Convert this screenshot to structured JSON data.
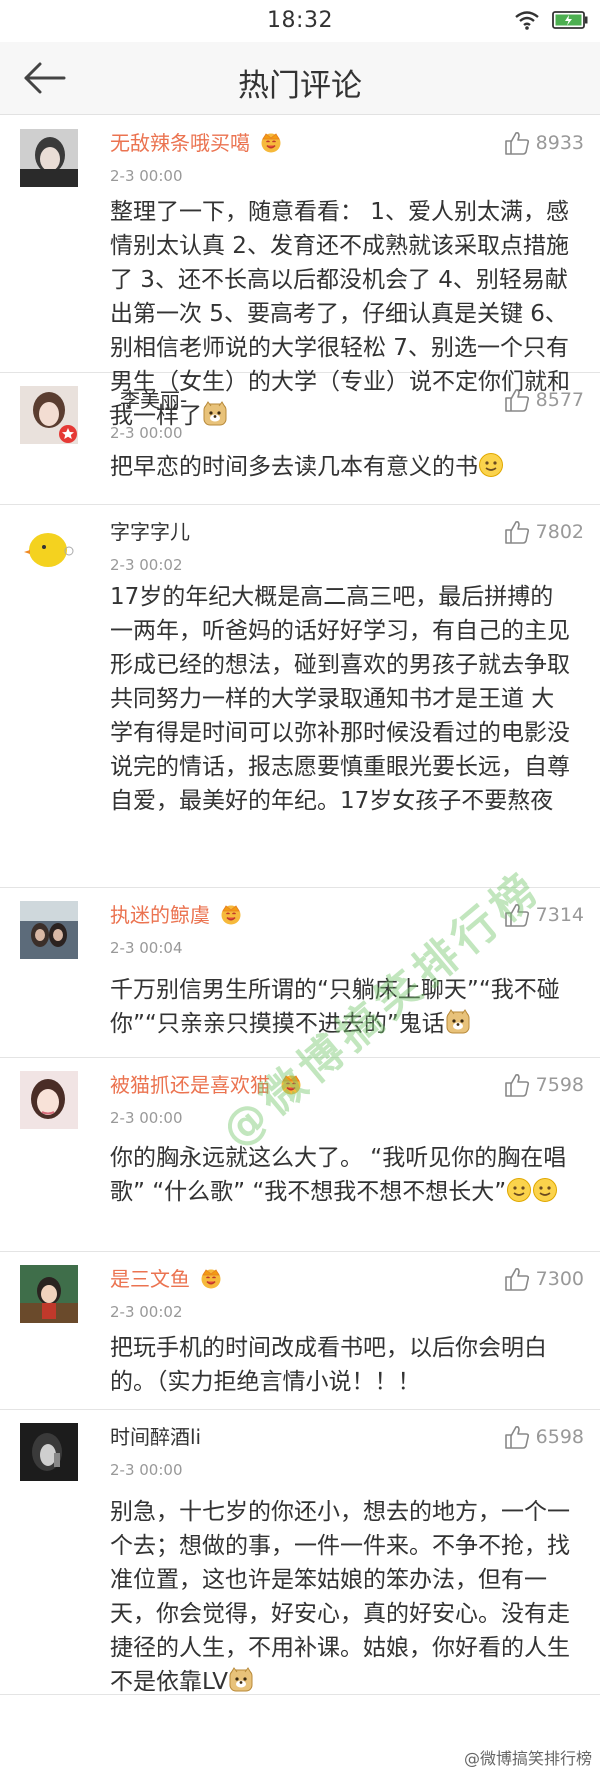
{
  "status_bar": {
    "time": "18:32",
    "icons": [
      "wifi-icon",
      "battery-icon"
    ]
  },
  "header": {
    "title": "热门评论",
    "back_icon": "back-arrow-icon"
  },
  "colors": {
    "accent_orange": "#eb7350",
    "gray_text": "#999999",
    "divider": "#e4e4e4"
  },
  "comments": [
    {
      "user": "无敌辣条哦买噶",
      "vip": true,
      "time": "2-3 00:00",
      "likes": "8933",
      "text": "整理了一下，随意看看： 1、爱人别太满，感情别太认真 2、发育还不成熟就该采取点措施了 3、还不长高以后都没机会了 4、别轻易献出第一次 5、要高考了，仔细认真是关键 6、别相信老师说的大学很轻松 7、别选一个只有男生（女生）的大学（专业）说不定你们就和我一样了"
    },
    {
      "user": "_李美丽-",
      "vip": false,
      "time": "2-3 00:00",
      "likes": "8577",
      "text": "把早恋的时间多去读几本有意义的书"
    },
    {
      "user": "字字字儿",
      "vip": false,
      "time": "2-3 00:02",
      "likes": "7802",
      "text": "17岁的年纪大概是高二高三吧，最后拼搏的一两年，听爸妈的话好好学习，有自己的主见形成已经的想法，碰到喜欢的男孩子就去争取 共同努力一样的大学录取通知书才是王道 大学有得是时间可以弥补那时候没看过的电影没说完的情话，报志愿要慎重眼光要长远，自尊自爱，最美好的年纪。17岁女孩子不要熬夜"
    },
    {
      "user": "执迷的鲸虞",
      "vip": true,
      "time": "2-3 00:04",
      "likes": "7314",
      "text": "千万别信男生所谓的“只躺床上聊天”“我不碰你”“只亲亲只摸摸不进去的”鬼话"
    },
    {
      "user": "被猫抓还是喜欢猫",
      "vip": true,
      "time": "2-3 00:00",
      "likes": "7598",
      "text": "你的胸永远就这么大了。 “我听见你的胸在唱歌” “什么歌” “我不想我不想不想长大”"
    },
    {
      "user": "是三文鱼",
      "vip": true,
      "time": "2-3 00:02",
      "likes": "7300",
      "text": "把玩手机的时间改成看书吧，以后你会明白的。（实力拒绝言情小说！！！"
    },
    {
      "user": "时间醉酒li",
      "vip": false,
      "time": "2-3 00:00",
      "likes": "6598",
      "text": "别急，十七岁的你还小，想去的地方，一个一个去；想做的事，一件一件来。不争不抢，找准位置，这也许是笨姑娘的笨办法，但有一天，你会觉得，好安心，真的好安心。没有走捷径的人生，不用补课。姑娘，你好看的人生不是依靠LV"
    }
  ],
  "watermark": "@微博搞笑排行榜",
  "footer_watermark": "@微博搞笑排行榜"
}
